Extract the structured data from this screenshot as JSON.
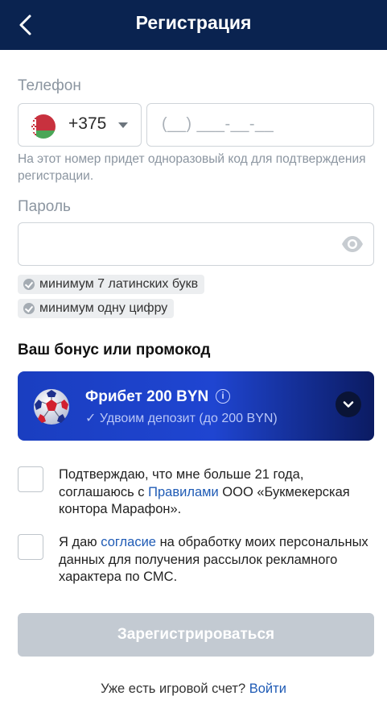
{
  "header": {
    "title": "Регистрация"
  },
  "phone": {
    "label": "Телефон",
    "country_code": "+375",
    "mask": "(__) ___-__-__",
    "hint": "На этот номер придет одноразовый код для подтверждения регистрации."
  },
  "password": {
    "label": "Пароль",
    "requirements": [
      "минимум 7 латинских букв",
      "минимум одну цифру"
    ]
  },
  "bonus": {
    "section_title": "Ваш бонус или промокод",
    "title": "Фрибет 200 BYN",
    "subtitle": "✓ Удвоим депозит (до 200 BYN)",
    "info_icon": "i"
  },
  "consents": {
    "age": {
      "before_link": "Подтверждаю, что мне больше 21 года, соглашаюсь с ",
      "link": "Правилами",
      "after_link": " ООО «Букмекерская контора Марафон»."
    },
    "sms": {
      "before_link": "Я даю ",
      "link": "согласие",
      "after_link": " на обработку моих персональных данных для получения рассылок рекламного характера по СМС."
    }
  },
  "submit_label": "Зарегистрироваться",
  "login": {
    "text": "Уже есть игровой счет? ",
    "link": "Войти"
  },
  "colors": {
    "header_bg": "#0a2350",
    "bonus_gradient_start": "#1a3ec0",
    "bonus_gradient_end": "#0b1b62",
    "link": "#1f5bb5",
    "submit_disabled": "#c3cad2"
  }
}
